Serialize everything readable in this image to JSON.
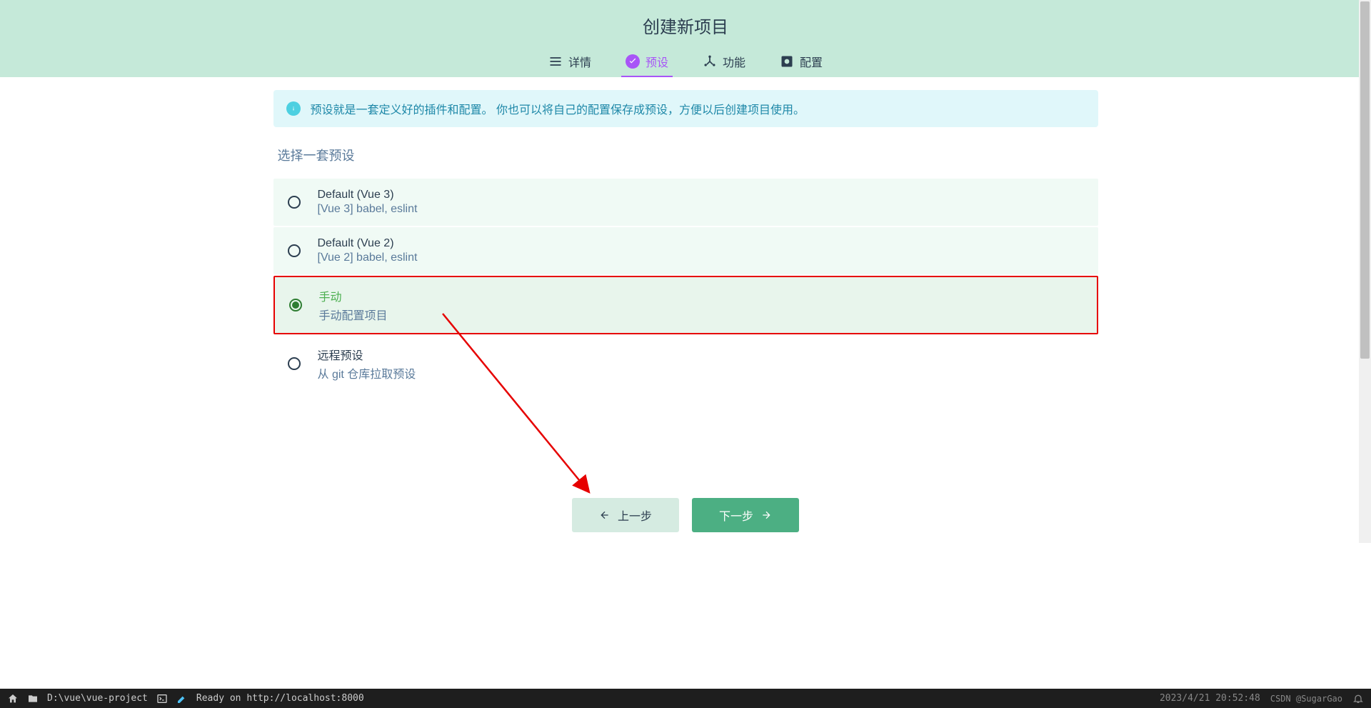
{
  "header": {
    "title": "创建新项目",
    "tabs": {
      "details": "详情",
      "preset": "预设",
      "features": "功能",
      "config": "配置"
    }
  },
  "info": {
    "text": "预设就是一套定义好的插件和配置。 你也可以将自己的配置保存成预设，方便以后创建项目使用。"
  },
  "section": {
    "title": "选择一套预设"
  },
  "presets": [
    {
      "title": "Default (Vue 3)",
      "desc": "[Vue 3] babel, eslint",
      "selected": false
    },
    {
      "title": "Default (Vue 2)",
      "desc": "[Vue 2] babel, eslint",
      "selected": false
    },
    {
      "title": "手动",
      "desc": "手动配置项目",
      "selected": true
    },
    {
      "title": "远程预设",
      "desc": "从 git 仓库拉取预设",
      "selected": false
    }
  ],
  "buttons": {
    "prev": "上一步",
    "next": "下一步"
  },
  "statusbar": {
    "path": "D:\\vue\\vue-project",
    "ready": "Ready on http://localhost:8000",
    "datetime": "2023/4/21 20:52:48",
    "watermark": "CSDN @SugarGao"
  }
}
